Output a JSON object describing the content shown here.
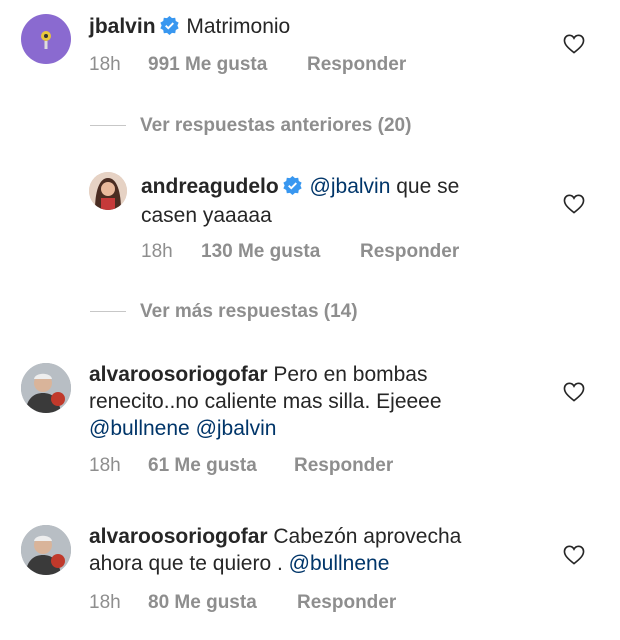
{
  "comments": [
    {
      "user": "jbalvin",
      "verified": true,
      "text": "Matrimonio",
      "time": "18h",
      "likes": "991 Me gusta",
      "reply": "Responder"
    },
    {
      "user": "andreagudelo",
      "verified": true,
      "mention": "@jbalvin",
      "text_rest_line1": " que se",
      "text_line2": "casen yaaaaa",
      "time": "18h",
      "likes": "130 Me gusta",
      "reply": "Responder"
    },
    {
      "user": "alvaroosoriogofar",
      "text_line1": " Pero en bombas",
      "text_line2": "renecito..no caliente mas silla. Ejeeee",
      "mention1": "@bullnene",
      "mention2": "@jbalvin",
      "time": "18h",
      "likes": "61 Me gusta",
      "reply": "Responder"
    },
    {
      "user": "alvaroosoriogofar",
      "text_line1": " Cabezón aprovecha",
      "text_line2": "ahora que te quiero . ",
      "mention": "@bullnene",
      "time": "18h",
      "likes": "80 Me gusta",
      "reply": "Responder"
    }
  ],
  "view_previous": "Ver respuestas anteriores (20)",
  "view_more": "Ver más respuestas (14)",
  "colors": {
    "mention": "#003569",
    "meta": "#8e8e8e",
    "verified": "#3897f0"
  }
}
